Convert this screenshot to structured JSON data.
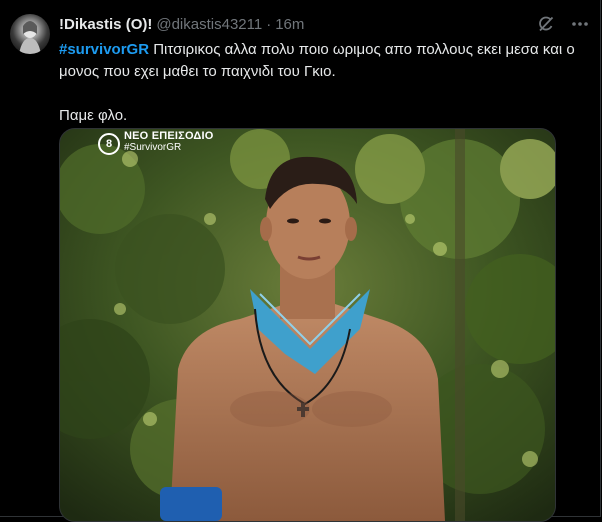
{
  "author": {
    "display_name": "!Dikastis (O)!",
    "handle": "@dikastis43211",
    "separator": "·",
    "time": "16m"
  },
  "tweet": {
    "hashtag": "#survivorGR",
    "text_line1": " Πιτσιρικος αλλα πολυ ποιο ωριμος απο πολλους εκει μεσα και ο μονος που εχει μαθει το παιχνιδι του Γκιο.",
    "text_line2": "Παμε φλο."
  },
  "media": {
    "channel_number": "8",
    "overlay_line1": "ΝΕΟ ΕΠΕΙΣΟΔΙΟ",
    "overlay_line2": "#SurvivorGR"
  },
  "icons": {
    "grok": "grok-icon",
    "more": "more-icon"
  },
  "colors": {
    "background": "#000000",
    "text": "#e7e9ea",
    "muted": "#71767b",
    "hashtag": "#1d9bf0",
    "border": "#2f3336"
  }
}
